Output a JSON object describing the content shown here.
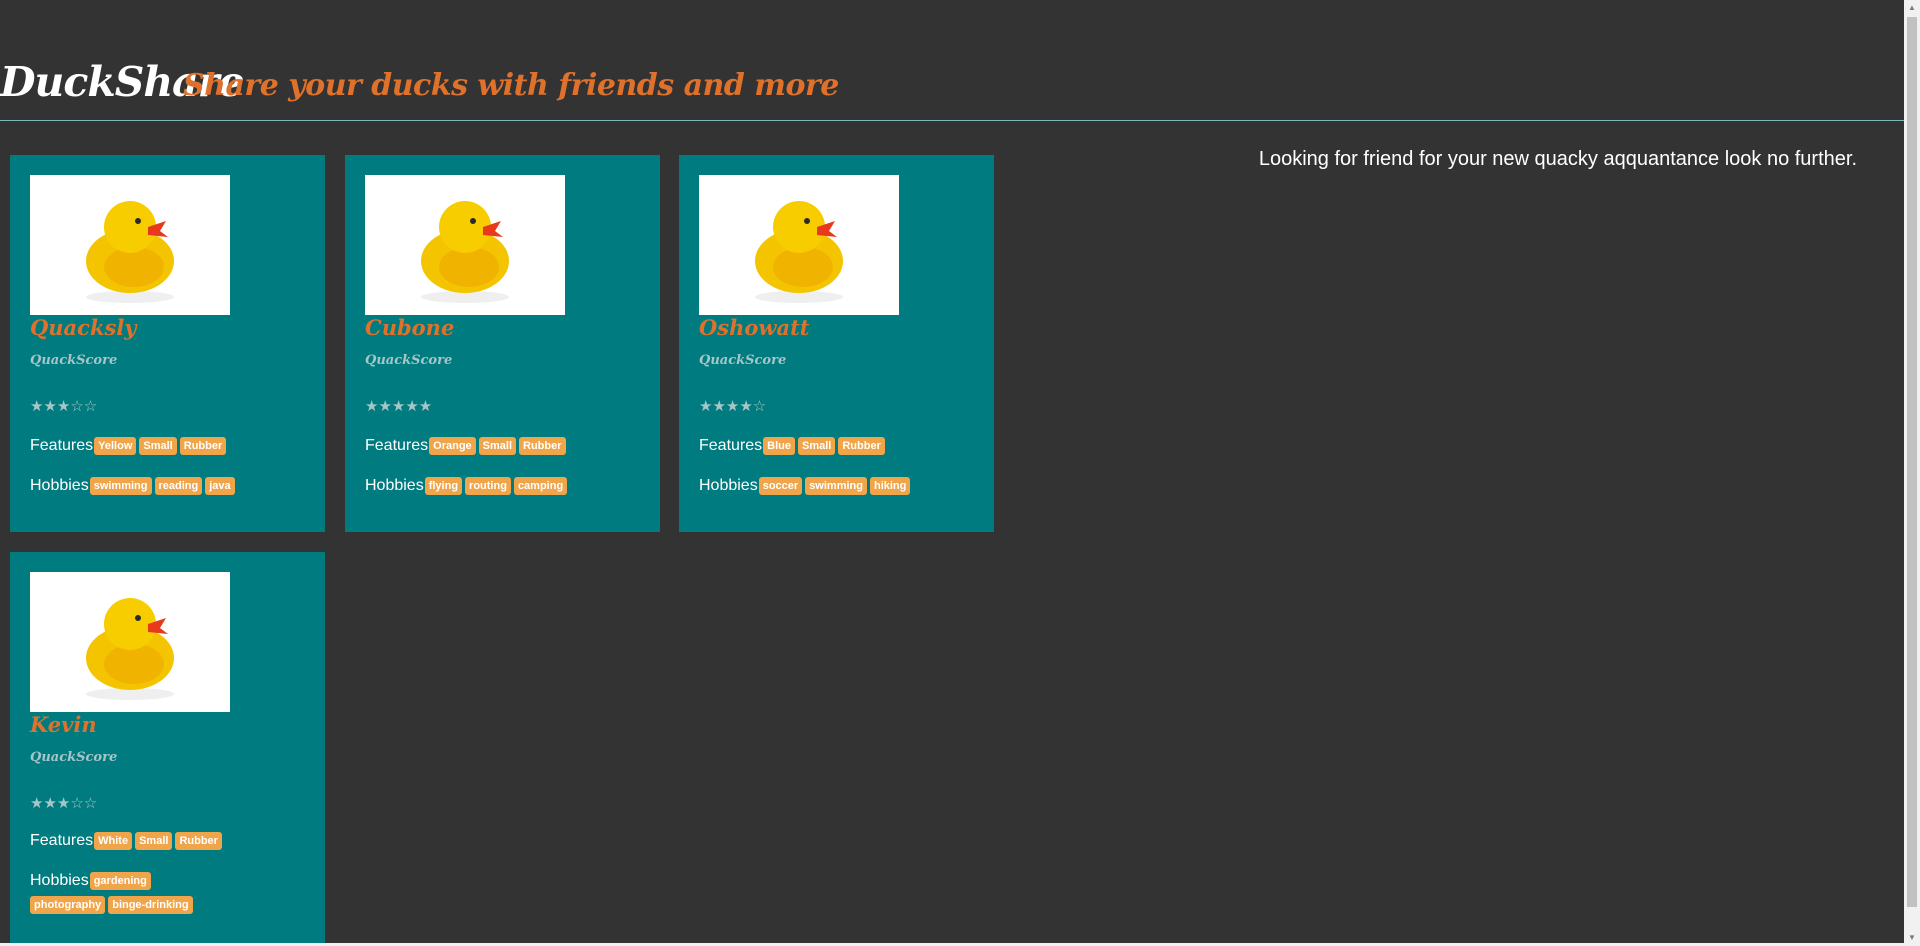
{
  "header": {
    "brand": "DuckShare",
    "tagline": "Share your ducks with friends and more"
  },
  "intro": "Looking for friend for your new quacky aqquantance look no further.",
  "cards": [
    {
      "name": "Quacksly",
      "score_label": "QuackScore",
      "rating": 3,
      "stars": "★★★☆☆",
      "features_label": "Features",
      "features": [
        "Yellow",
        "Small",
        "Rubber"
      ],
      "hobbies_label": "Hobbies",
      "hobbies": [
        "swimming",
        "reading",
        "java"
      ]
    },
    {
      "name": "Cubone",
      "score_label": "QuackScore",
      "rating": 5,
      "stars": "★★★★★",
      "features_label": "Features",
      "features": [
        "Orange",
        "Small",
        "Rubber"
      ],
      "hobbies_label": "Hobbies",
      "hobbies": [
        "flying",
        "routing",
        "camping"
      ]
    },
    {
      "name": "Oshowatt",
      "score_label": "QuackScore",
      "rating": 4,
      "stars": "★★★★☆",
      "features_label": "Features",
      "features": [
        "Blue",
        "Small",
        "Rubber"
      ],
      "hobbies_label": "Hobbies",
      "hobbies": [
        "soccer",
        "swimming",
        "hiking"
      ]
    },
    {
      "name": "Kevin",
      "score_label": "QuackScore",
      "rating": 3,
      "stars": "★★★☆☆",
      "features_label": "Features",
      "features": [
        "White",
        "Small",
        "Rubber"
      ],
      "hobbies_label": "Hobbies",
      "hobbies": [
        "gardening",
        "photography",
        "binge-drinking"
      ]
    }
  ],
  "colors": {
    "background": "#333333",
    "card": "#007b7f",
    "accent": "#e0712a",
    "tag": "#f0a54a"
  },
  "icons": {
    "photo": "rubber-duck-image",
    "rating": "star-icon"
  }
}
